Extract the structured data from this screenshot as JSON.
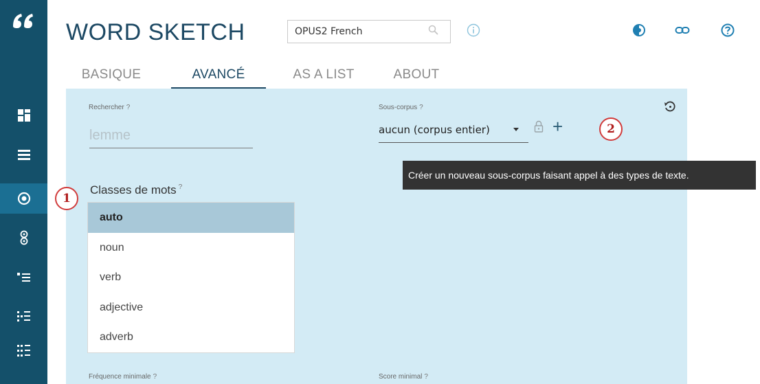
{
  "app": {
    "title": "WORD SKETCH"
  },
  "corpus": {
    "value": "OPUS2 French"
  },
  "tabs": [
    {
      "label": "BASIQUE"
    },
    {
      "label": "AVANCÉ"
    },
    {
      "label": "AS A LIST"
    },
    {
      "label": "ABOUT"
    }
  ],
  "form": {
    "search_label": "Rechercher",
    "search_help": "?",
    "search_placeholder": "lemme",
    "subcorpus_label": "Sous-corpus",
    "subcorpus_help": "?",
    "subcorpus_value": "aucun (corpus entier)",
    "word_class_label": "Classes de mots",
    "word_class_help": "?",
    "word_classes": [
      "auto",
      "noun",
      "verb",
      "adjective",
      "adverb"
    ],
    "selected_word_class": "auto",
    "min_freq_label": "Fréquence minimale",
    "min_freq_help": "?",
    "min_score_label": "Score minimal",
    "min_score_help": "?"
  },
  "tooltip": {
    "text": "Créer un nouveau sous-corpus faisant appel à des types de texte."
  },
  "callouts": {
    "one": "1",
    "two": "2"
  },
  "colors": {
    "sidebar": "#14506a",
    "sidebar_active": "#1b6f93",
    "panel": "#d3ebf5",
    "accent": "#1c4863",
    "callout": "#d13b3b"
  },
  "icons": [
    "logo-icon",
    "dashboard-icon",
    "list-icon",
    "target-icon",
    "two-circles-icon",
    "bullet-list-icon",
    "dotted-list-icon",
    "grid-list-icon",
    "search-icon",
    "info-icon",
    "theme-icon",
    "link-icon",
    "help-icon",
    "lock-icon",
    "plus-icon",
    "reset-icon"
  ]
}
